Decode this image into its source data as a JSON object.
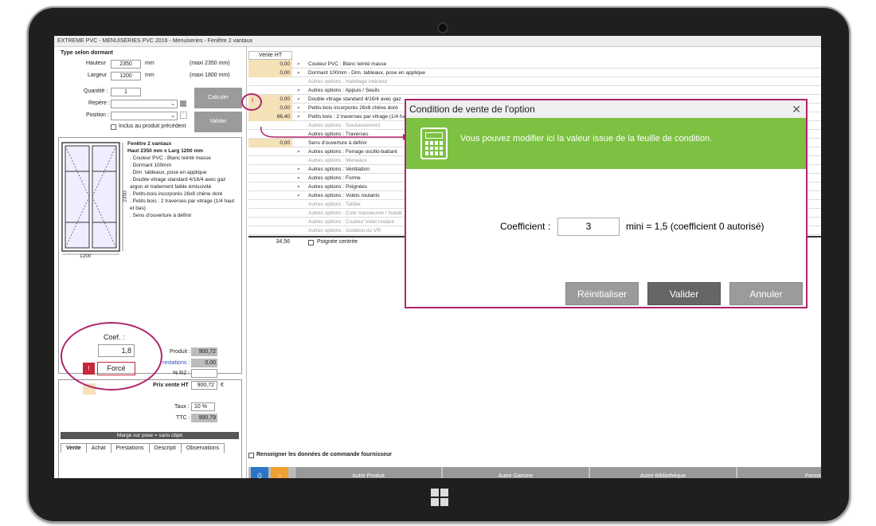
{
  "window": {
    "title": "EXTREME PVC - MENUISERIES PVC 2016 - Menuiseries - Fenêtre 2 vantaux"
  },
  "form": {
    "type_header": "Type selon dormant",
    "hauteur_label": "Hauteur",
    "hauteur_value": "2350",
    "hauteur_unit": "mm",
    "hauteur_max": "(maxi 2350 mm)",
    "largeur_label": "Largeur",
    "largeur_value": "1200",
    "largeur_unit": "mm",
    "largeur_max": "(maxi 1800 mm)",
    "quantite_label": "Quantité :",
    "quantite_value": "1",
    "repere_label": "Repère :",
    "position_label": "Position :",
    "inclus_label": "Inclus au produit précédent",
    "calculer_label": "Calculer",
    "valider_label": "Valider"
  },
  "drawing": {
    "height_dim": "2350",
    "width_dim": "1200"
  },
  "description": {
    "title": "Fenêtre 2 vantaux",
    "subtitle": "Haut 2350 mm x Larg 1200 mm",
    "lines": [
      ". Couleur PVC : Blanc teinté masse",
      ". Dormant 100mm",
      ". Dim. tableaux, pose en applique",
      ". Double vitrage standard 4/16/4 avec gaz argon et traitement faible émissivité",
      ". Petits-bois incorporés 26x8 chêne doré",
      ". Petits bois : 2 traverses par vitrage (1/4 haut et bas)",
      ". Sens d'ouverture à définir"
    ]
  },
  "pricing": {
    "coef_label": "Coef. :",
    "coef_value": "1,8",
    "force_label": "Forcé",
    "warn": "!",
    "produit_label": "Produit :",
    "produit_value": "900,72",
    "prestations_label": "restations :",
    "prestations_value": "0,00",
    "r2_label": "% R2 :",
    "prix_label": "Prix vente HT",
    "prix_value": "900,72",
    "euro": "€",
    "taux_label": "Taux :",
    "taux_value": "10 %",
    "ttc_label": "TTC :",
    "ttc_value": "990,79",
    "marge": "Marge sur pose = sans objet"
  },
  "tabs": [
    "Vente",
    "Achat",
    "Prestations",
    "Descripti",
    "Observations"
  ],
  "grid": {
    "header": "Vente HT",
    "rows": [
      {
        "value": "0,00",
        "icon": "⌕",
        "text": "Couleur PVC : Blanc teinté masse",
        "grey": false,
        "beige": true
      },
      {
        "value": "0,00",
        "icon": "⌕",
        "text": "Dormant 100mm - Dim. tableaux, pose en applique",
        "grey": false,
        "beige": true
      },
      {
        "value": "",
        "icon": "",
        "text": "Autres options : Habillage intérieur",
        "grey": true,
        "beige": false
      },
      {
        "value": "",
        "icon": "⌕",
        "text": "Autres options : Appuis / Seuils",
        "grey": false,
        "beige": false
      },
      {
        "value": "0,00",
        "icon": "⌕",
        "text": "Double vitrage standard 4/16/4 avec gaz",
        "grey": false,
        "beige": true
      },
      {
        "value": "0,00",
        "icon": "⌕",
        "text": "Petits-bois incorporés 26x8 chêne doré",
        "grey": false,
        "beige": true
      },
      {
        "value": "86,40",
        "icon": "⌕",
        "text": "Petits bois : 2 traverses par vitrage (1/4 ha",
        "grey": false,
        "beige": true
      },
      {
        "value": "",
        "icon": "",
        "text": "Autres options : Soubassement",
        "grey": true,
        "beige": false
      },
      {
        "value": "",
        "icon": "",
        "text": "Autres options : Traverses",
        "grey": false,
        "beige": false
      },
      {
        "value": "0,00",
        "icon": "",
        "text": "Sens d'ouverture à définir",
        "grey": false,
        "beige": true
      },
      {
        "value": "",
        "icon": "⌕",
        "text": "Autres options : Ferrage oscillo-battant",
        "grey": false,
        "beige": false
      },
      {
        "value": "",
        "icon": "",
        "text": "Autres options : Meneaux",
        "grey": true,
        "beige": false
      },
      {
        "value": "",
        "icon": "⌕",
        "text": "Autres options : Ventilation",
        "grey": false,
        "beige": false
      },
      {
        "value": "",
        "icon": "⌕",
        "text": "Autres options : Forme",
        "grey": false,
        "beige": false
      },
      {
        "value": "",
        "icon": "⌕",
        "text": "Autres options : Poignées",
        "grey": false,
        "beige": false
      },
      {
        "value": "",
        "icon": "⌕",
        "text": "Autres options : Volets roulants",
        "grey": false,
        "beige": false
      },
      {
        "value": "",
        "icon": "",
        "text": "Autres options : Tablier",
        "grey": true,
        "beige": false
      },
      {
        "value": "",
        "icon": "",
        "text": "Autres options : Coté manoeuvre / Isolati",
        "grey": true,
        "beige": false
      },
      {
        "value": "",
        "icon": "",
        "text": "Autres options : Couleur Volet roulant",
        "grey": true,
        "beige": false
      },
      {
        "value": "",
        "icon": "",
        "text": "Autres options : Isolation du VR",
        "grey": true,
        "beige": false
      }
    ],
    "marker": "!",
    "total": "34,56",
    "poignee_label": "Poignée centrée"
  },
  "renseigner_label": "Renseigner les données de commande fournisseur",
  "toolbar": {
    "autre_produit": "Autre Produit",
    "autre_gamme": "Autre Gamme",
    "autre_bibliotheque": "Autre Bibliothèque",
    "fermer": "Fermer"
  },
  "dialog": {
    "title": "Condition de vente de l'option",
    "message": "Vous pouvez modifier ici la valeur issue de la feuille de condition.",
    "coef_label": "Coefficient :",
    "coef_value": "3",
    "hint": "mini = 1,5 (coefficient 0 autorisé)",
    "reset_label": "Réinitialiser",
    "validate_label": "Valider",
    "cancel_label": "Annuler",
    "close": "✕"
  },
  "colors": {
    "accent": "#b0246c",
    "green": "#7dc142",
    "beige": "#f4e1b8"
  }
}
